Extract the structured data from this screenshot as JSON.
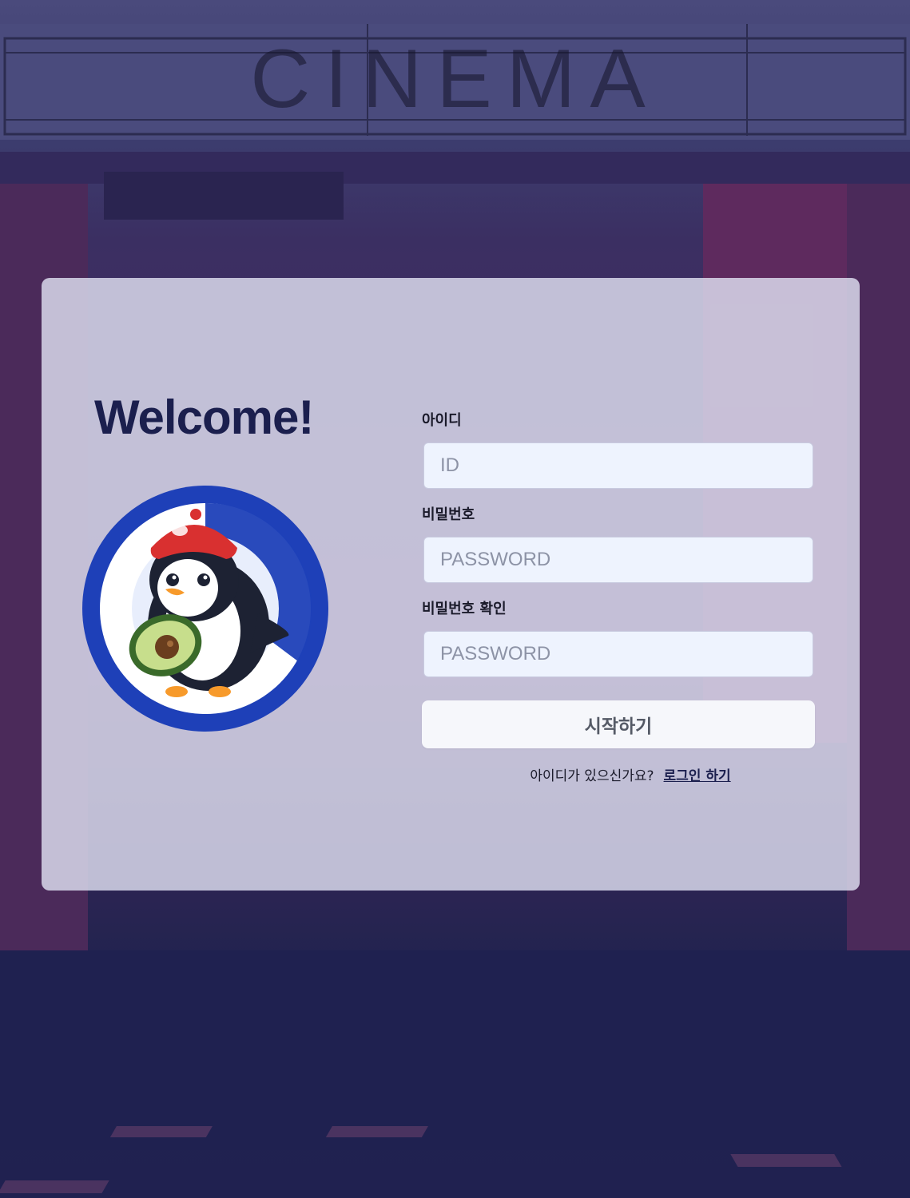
{
  "background": {
    "sign_text": "CINEMA",
    "base_color": "#1f2150"
  },
  "card": {
    "welcome": "Welcome!",
    "mascot": {
      "icon": "penguin-avocado-mascot-icon",
      "ring_color": "#1e40b8",
      "hat_color": "#d93030"
    }
  },
  "form": {
    "id": {
      "label": "아이디",
      "placeholder": "ID",
      "value": ""
    },
    "password": {
      "label": "비밀번호",
      "placeholder": "PASSWORD",
      "value": ""
    },
    "password_confirm": {
      "label": "비밀번호 확인",
      "placeholder": "PASSWORD",
      "value": ""
    },
    "submit_label": "시작하기",
    "switch_prompt": "아이디가 있으신가요?",
    "switch_link": "로그인 하기"
  }
}
